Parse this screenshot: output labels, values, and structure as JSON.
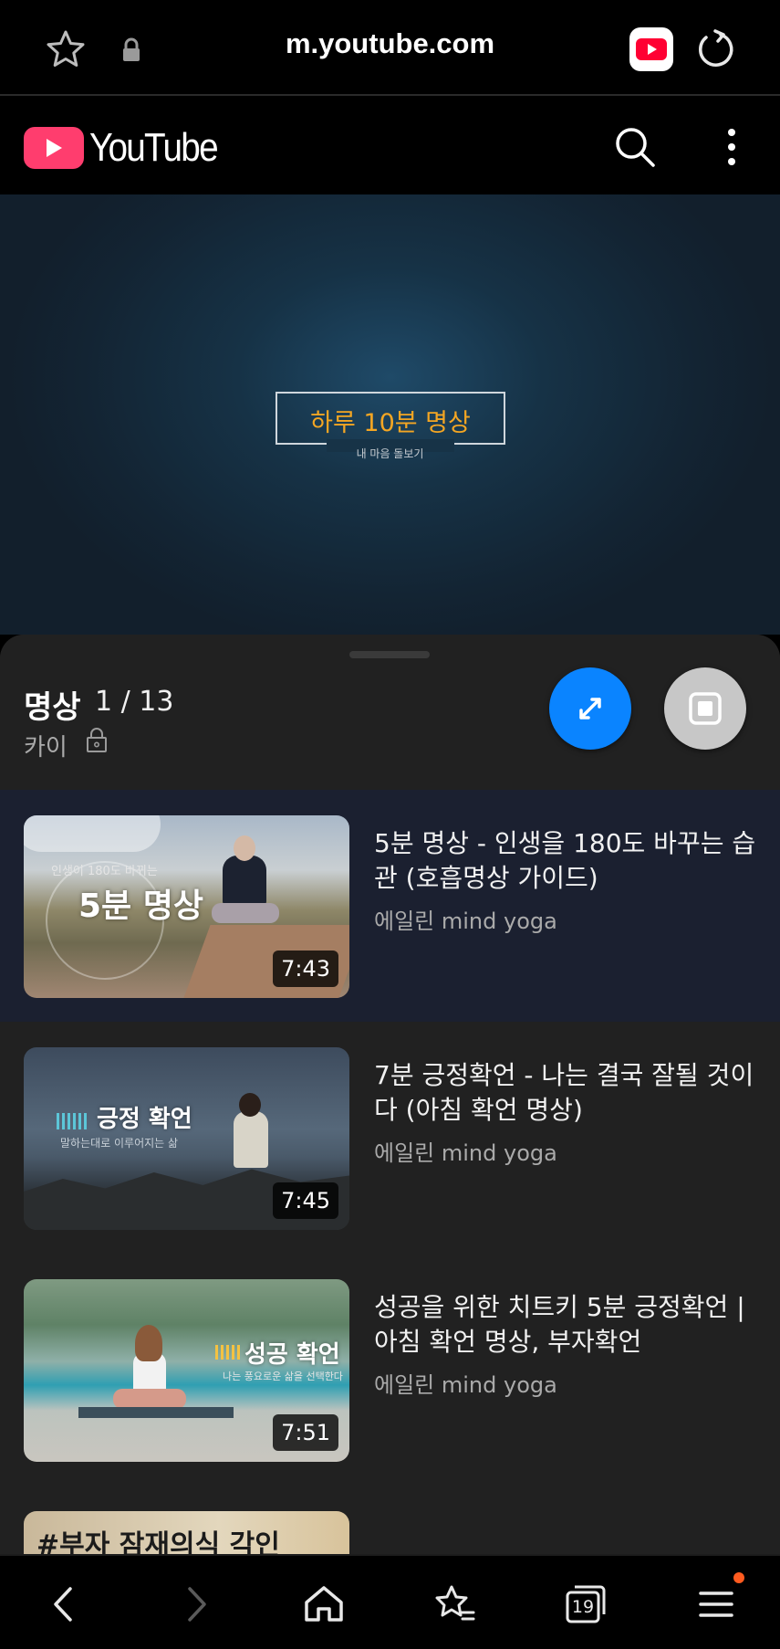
{
  "browser": {
    "url": "m.youtube.com",
    "icons": [
      "star-icon",
      "lock-icon",
      "youtube-app-icon",
      "reload-icon"
    ]
  },
  "header": {
    "wordmark": "YouTube",
    "icons": [
      "search-icon",
      "more-vert-icon"
    ],
    "brand_color": "#ff3d6e"
  },
  "player": {
    "title": "하루 10분 명상",
    "subtitle": "내 마음 돌보기"
  },
  "playlist": {
    "name": "명상",
    "position": "1 / 13",
    "owner": "카이",
    "accent_color": "#0a84ff",
    "items": [
      {
        "title": "5분 명상 - 인생을 180도 바꾸는 습관 (호흡명상 가이드)",
        "channel": "에일린 mind yoga",
        "duration": "7:43",
        "thumb_title": "5분 명상",
        "thumb_caption": "인생이 180도 바뀌는",
        "active": true
      },
      {
        "title": "7분 긍정확언 - 나는 결국 잘될 것이다 (아침 확언 명상)",
        "channel": "에일린 mind yoga",
        "duration": "7:45",
        "thumb_title": "긍정 확언",
        "thumb_caption": "말하는대로 이루어지는 삶"
      },
      {
        "title": "성공을 위한 치트키 5분 긍정확언 | 아침 확언 명상, 부자확언",
        "channel": "에일린 mind yoga",
        "duration": "7:51",
        "thumb_title": "성공 확언",
        "thumb_caption": "나는 풍요로운 삶을 선택한다"
      },
      {
        "thumb_title": "#부자 잠재의식 각인"
      }
    ]
  },
  "bottom_nav": {
    "tab_count": "19",
    "icons": [
      "back-icon",
      "forward-icon",
      "home-icon",
      "bookmarks-icon",
      "tabs-icon",
      "menu-icon"
    ]
  }
}
